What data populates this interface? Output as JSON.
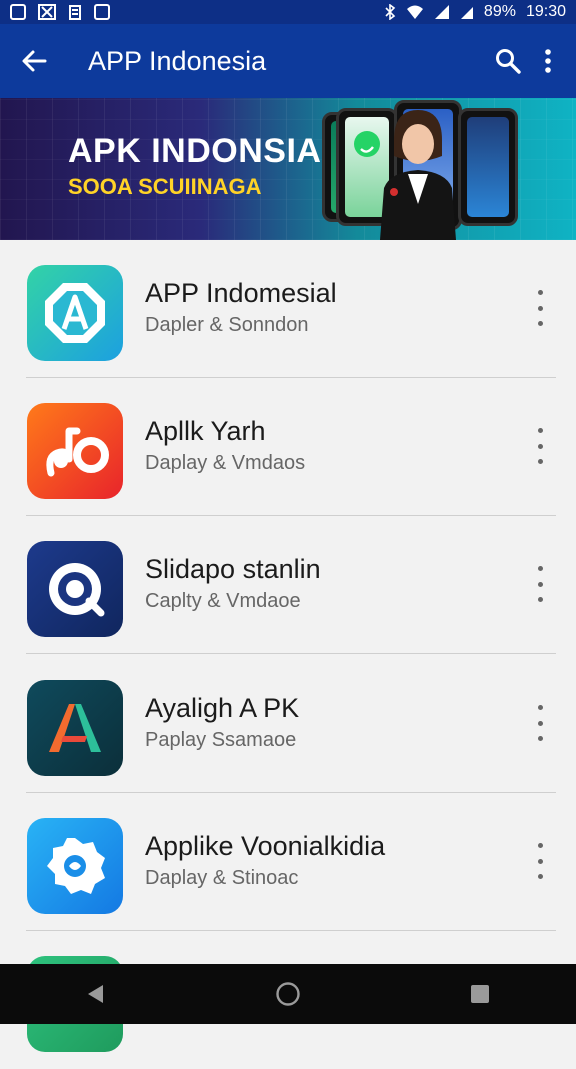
{
  "status_bar": {
    "battery": "89%",
    "time": "19:30"
  },
  "app_bar": {
    "title": "APP Indonesia"
  },
  "banner": {
    "headline": "APK INDONSIA",
    "subline": "SOOA SCUIINAGA"
  },
  "apps": [
    {
      "name": "APP Indomesial",
      "subtitle": "Dapler & Sonndon"
    },
    {
      "name": "Apllk Yarh",
      "subtitle": "Daplay & Vmdaos"
    },
    {
      "name": "Slidapo stanlin",
      "subtitle": "Caplty & Vmdaoe"
    },
    {
      "name": "Ayaligh A PK",
      "subtitle": "Paplay Ssamaoe"
    },
    {
      "name": "Applike Voonialkidia",
      "subtitle": "Daplay & Stinoac"
    }
  ],
  "colors": {
    "status_bar": "#0d2f86",
    "app_bar": "#0d3a9c",
    "subline": "#ffd327"
  }
}
